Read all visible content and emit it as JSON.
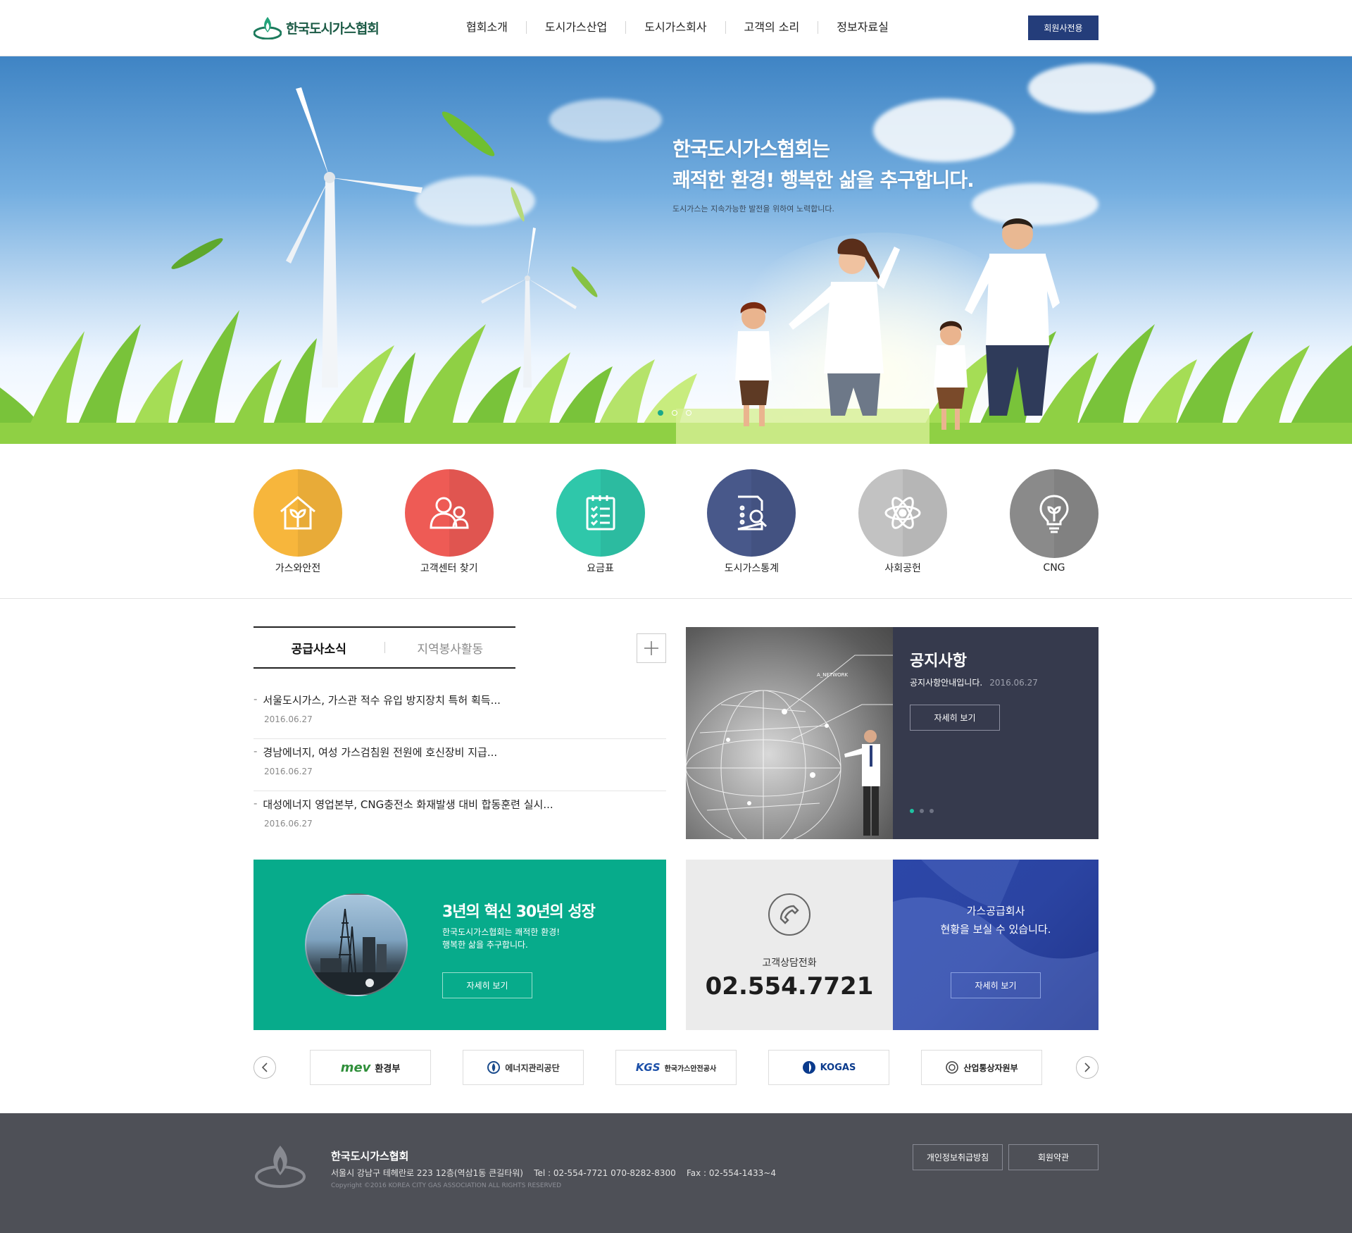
{
  "header": {
    "logo_text": "한국도시가스협회",
    "nav": [
      "협회소개",
      "도시가스산업",
      "도시가스회사",
      "고객의 소리",
      "정보자료실"
    ],
    "member_button": "회원사전용"
  },
  "hero": {
    "title_line1": "한국도시가스협회는",
    "title_line2": "쾌적한 환경! 행복한 삶을 추구합니다.",
    "subtitle": "도시가스는 지속가능한 발전을 위하여 노력합니다.",
    "slide_count": 3,
    "active_slide": 1
  },
  "quick_links": [
    {
      "label": "가스와안전",
      "color": "#f7b63c",
      "icon": "house-sprout-icon"
    },
    {
      "label": "고객센터 찾기",
      "color": "#ee5b55",
      "icon": "people-icon"
    },
    {
      "label": "요금표",
      "color": "#2fc7aa",
      "icon": "checklist-icon"
    },
    {
      "label": "도시가스통계",
      "color": "#48588a",
      "icon": "document-search-icon"
    },
    {
      "label": "사회공헌",
      "color": "#c2c2c2",
      "icon": "atom-icon"
    },
    {
      "label": "CNG",
      "color": "#8a8a8a",
      "icon": "lightbulb-sprout-icon"
    }
  ],
  "news": {
    "tabs": [
      "공급사소식",
      "지역봉사활동"
    ],
    "active_tab": 0,
    "items": [
      {
        "title": "서울도시가스, 가스관 적수 유입 방지장치 특허 획득...",
        "date": "2016.06.27"
      },
      {
        "title": "경남에너지, 여성 가스검침원 전원에 호신장비 지급...",
        "date": "2016.06.27"
      },
      {
        "title": "대성에너지 영업본부, CNG충전소 화재발생 대비 합동훈련 실시...",
        "date": "2016.06.27"
      }
    ]
  },
  "notice": {
    "title": "공지사항",
    "text": "공지사항안내입니다.",
    "date": "2016.06.27",
    "button": "자세히 보기",
    "image_caption": "A_NETWORK",
    "slide_count": 3,
    "active_slide": 0
  },
  "promo": {
    "title": "3년의 혁신 30년의 성장",
    "line1": "한국도시가스협회는 쾌적한 환경!",
    "line2": "행복한 삶을 추구합니다.",
    "button": "자세히 보기"
  },
  "phone": {
    "label": "고객상담전화",
    "number": "02.554.7721"
  },
  "gas_companies": {
    "line1": "가스공급회사",
    "line2": "현황을 보실 수 있습니다.",
    "button": "자세히 보기"
  },
  "partners": [
    {
      "name": "환경부",
      "mark": "mev"
    },
    {
      "name": "에너지관리공단",
      "mark": ""
    },
    {
      "name": "한국가스안전공사",
      "mark": "KGS"
    },
    {
      "name": "KOGAS",
      "mark": ""
    },
    {
      "name": "산업통상자원부",
      "mark": ""
    }
  ],
  "footer": {
    "name": "한국도시가스협회",
    "address": "서울시 강남구 테헤란로 223 12층(역삼1동 큰길타워)    Tel : 02-554-7721 070-8282-8300    Fax : 02-554-1433~4",
    "copyright": "Copyright ©2016 KOREA CITY GAS ASSOCIATION ALL RIGHTS RESERVED",
    "privacy_button": "개인정보취급방침",
    "terms_button": "회원약관"
  },
  "colors": {
    "navy": "#243d7a",
    "teal": "#07ab8b",
    "notice_bg": "#363a4d",
    "footer_bg": "#4e5057"
  }
}
